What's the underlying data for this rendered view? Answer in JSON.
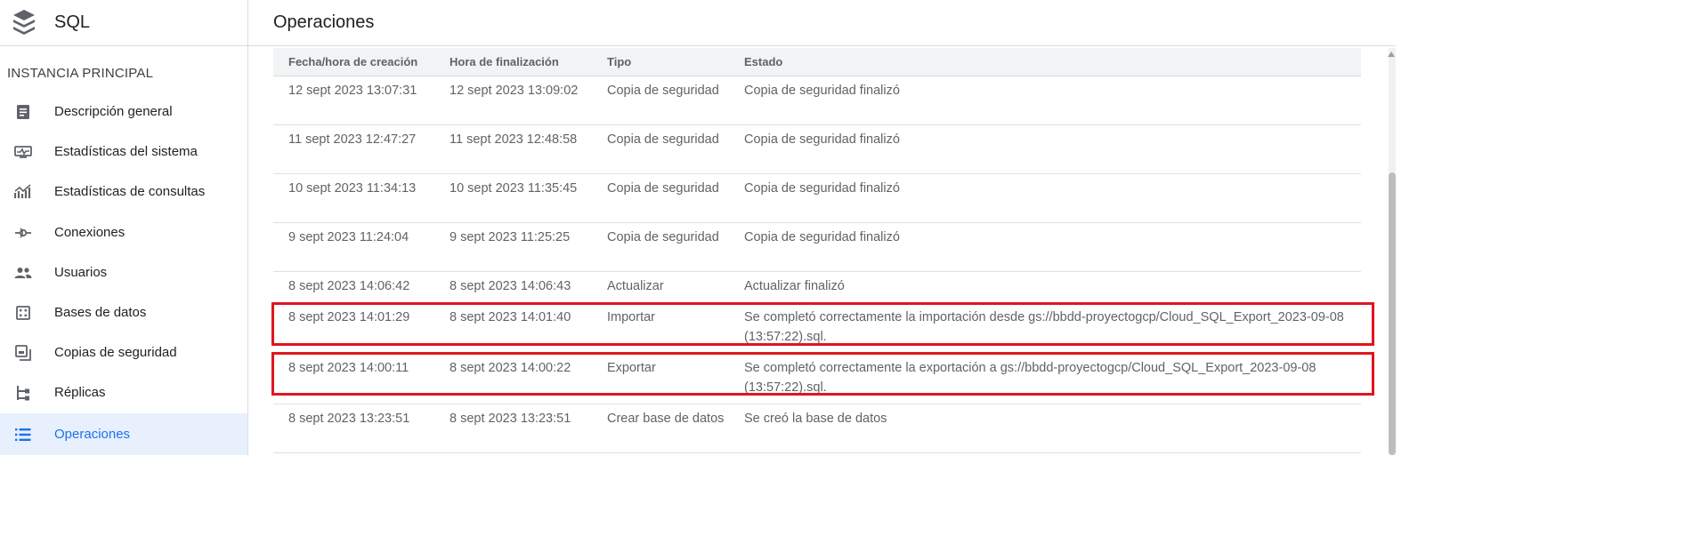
{
  "sidebar": {
    "product_title": "SQL",
    "section_title": "INSTANCIA PRINCIPAL",
    "items": [
      {
        "label": "Descripción general",
        "icon": "document-icon"
      },
      {
        "label": "Estadísticas del sistema",
        "icon": "monitor-chart-icon"
      },
      {
        "label": "Estadísticas de consultas",
        "icon": "query-chart-icon"
      },
      {
        "label": "Conexiones",
        "icon": "connection-icon"
      },
      {
        "label": "Usuarios",
        "icon": "users-icon"
      },
      {
        "label": "Bases de datos",
        "icon": "database-icon"
      },
      {
        "label": "Copias de seguridad",
        "icon": "backup-icon"
      },
      {
        "label": "Réplicas",
        "icon": "replicas-icon"
      },
      {
        "label": "Operaciones",
        "icon": "list-icon",
        "active": true
      }
    ]
  },
  "main": {
    "title": "Operaciones",
    "table": {
      "headers": [
        "Fecha/hora de creación",
        "Hora de finalización",
        "Tipo",
        "Estado"
      ],
      "rows": [
        {
          "created": "12 sept 2023 13:07:31",
          "finished": "12 sept 2023 13:09:02",
          "type": "Copia de seguridad",
          "status": "Copia de seguridad finalizó"
        },
        {
          "created": "11 sept 2023 12:47:27",
          "finished": "11 sept 2023 12:48:58",
          "type": "Copia de seguridad",
          "status": "Copia de seguridad finalizó"
        },
        {
          "created": "10 sept 2023 11:34:13",
          "finished": "10 sept 2023 11:35:45",
          "type": "Copia de seguridad",
          "status": "Copia de seguridad finalizó"
        },
        {
          "created": "9 sept 2023 11:24:04",
          "finished": "9 sept 2023 11:25:25",
          "type": "Copia de seguridad",
          "status": "Copia de seguridad finalizó"
        },
        {
          "created": "8 sept 2023 14:06:42",
          "finished": "8 sept 2023 14:06:43",
          "type": "Actualizar",
          "status": "Actualizar finalizó"
        },
        {
          "created": "8 sept 2023 14:01:29",
          "finished": "8 sept 2023 14:01:40",
          "type": "Importar",
          "status": "Se completó correctamente la importación desde gs://bbdd-proyectogcp/Cloud_SQL_Export_2023-09-08 (13:57:22).sql."
        },
        {
          "created": "8 sept 2023 14:00:11",
          "finished": "8 sept 2023 14:00:22",
          "type": "Exportar",
          "status": "Se completó correctamente la exportación a gs://bbdd-proyectogcp/Cloud_SQL_Export_2023-09-08 (13:57:22).sql."
        },
        {
          "created": "8 sept 2023 13:23:51",
          "finished": "8 sept 2023 13:23:51",
          "type": "Crear base de datos",
          "status": "Se creó la base de datos"
        }
      ]
    }
  },
  "colors": {
    "accent": "#1a73e8",
    "active_bg": "#e8f0fe",
    "highlight": "#e0161e",
    "icon": "#5f6368"
  }
}
